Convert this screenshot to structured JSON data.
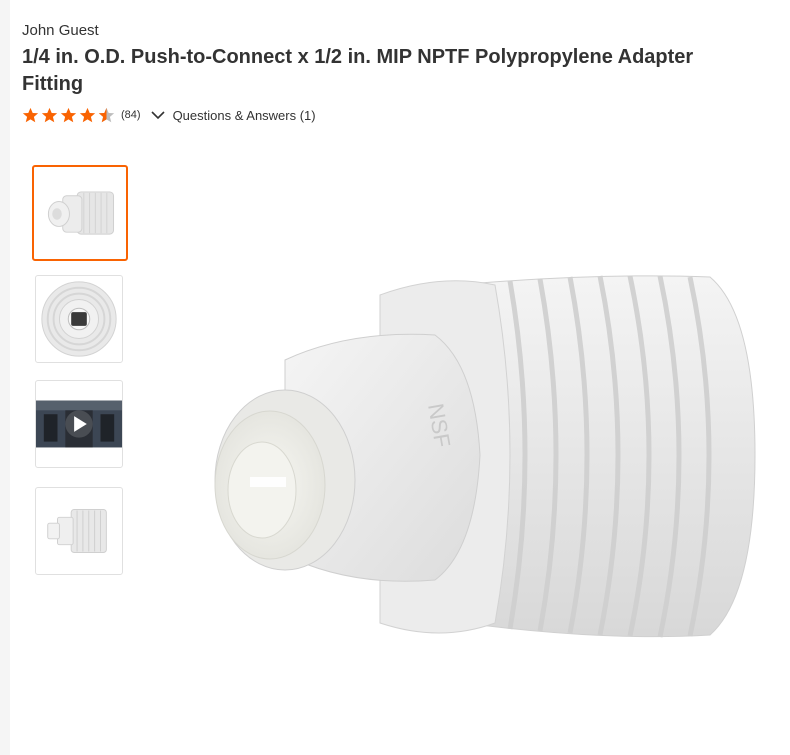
{
  "product": {
    "brand": "John Guest",
    "title": "1/4 in. O.D. Push-to-Connect x 1/2 in. MIP NPTF Polypropylene Adapter Fitting"
  },
  "rating": {
    "stars": 4.5,
    "review_count": "(84)",
    "qa_label": "Questions & Answers (1)",
    "star_color": "#f96302"
  },
  "gallery": {
    "thumbnails": [
      {
        "kind": "side-view",
        "selected": true
      },
      {
        "kind": "front-view",
        "selected": false
      },
      {
        "kind": "video",
        "selected": false
      },
      {
        "kind": "profile-view",
        "selected": false
      }
    ],
    "accent_color": "#f96302"
  },
  "main_image": {
    "icon": "adapter-fitting-photo",
    "embossed_text": "NSF"
  }
}
